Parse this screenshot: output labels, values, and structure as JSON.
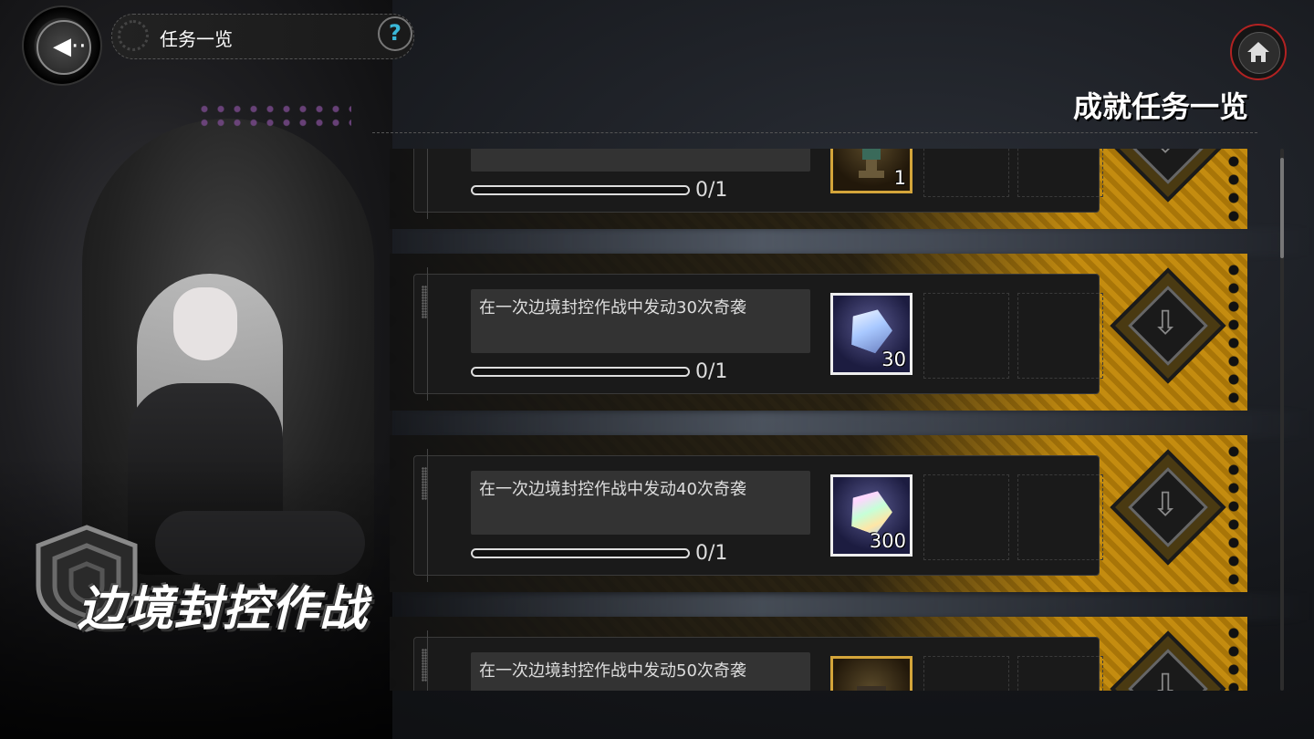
{
  "header": {
    "title": "任务一览",
    "help_label": "?",
    "page_heading": "成就任务一览"
  },
  "event": {
    "title": "边境封控作战"
  },
  "missions": [
    {
      "description": "",
      "progress": "0/1",
      "progress_fraction": 0,
      "reward": {
        "icon": "trophy-icon",
        "quantity": "1",
        "frame": "gold"
      }
    },
    {
      "description": "在一次边境封控作战中发动30次奇袭",
      "progress": "0/1",
      "progress_fraction": 0,
      "reward": {
        "icon": "crystal-gem-icon",
        "quantity": "30",
        "frame": "white"
      }
    },
    {
      "description": "在一次边境封控作战中发动40次奇袭",
      "progress": "0/1",
      "progress_fraction": 0,
      "reward": {
        "icon": "rainbow-crystal-icon",
        "quantity": "300",
        "frame": "white"
      }
    },
    {
      "description": "在一次边境封控作战中发动50次奇袭",
      "progress": "",
      "progress_fraction": 0,
      "reward": {
        "icon": "chest-icon",
        "quantity": "",
        "frame": "gold"
      }
    }
  ],
  "colors": {
    "accent_gold": "#c48c10",
    "help_blue": "#3ab8d8",
    "home_ring_red": "#b22222"
  }
}
